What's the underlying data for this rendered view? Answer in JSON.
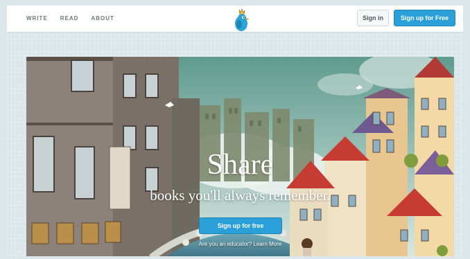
{
  "nav": {
    "write_label": "WRITE",
    "read_label": "READ",
    "about_label": "ABOUT"
  },
  "auth": {
    "signin_label": "Sign in",
    "signup_label": "Sign up for Free"
  },
  "hero": {
    "title": "Share",
    "subtitle": "books you'll always remember.",
    "cta_label": "Sign up for free",
    "educator_link": "Are you an educator? Learn More"
  },
  "colors": {
    "accent": "#2a9fd8",
    "logo_bird": "#2aa3d6",
    "crown": "#f0c43b"
  },
  "icons": {
    "logo": "bird-with-crown-icon"
  }
}
